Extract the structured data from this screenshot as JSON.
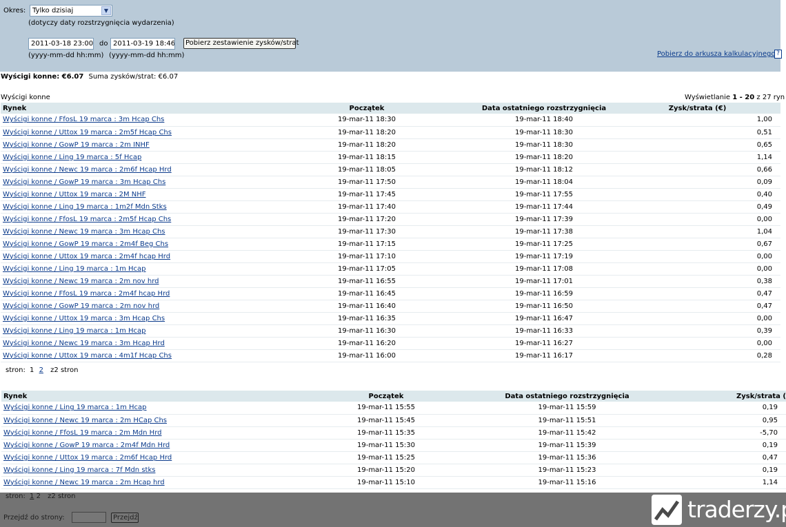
{
  "filter": {
    "period_label": "Okres:",
    "period_value": "Tylko dzisiaj",
    "period_note": "(dotyczy daty rozstrzygnięcia wydarzenia)",
    "date_from": "2011-03-18 23:00",
    "to_label": "do",
    "date_to": "2011-03-19 18:46",
    "fetch_button": "Pobierz zestawienie zysków/strat",
    "format_hint_from": "(yyyy-mm-dd hh:mm)",
    "format_hint_to": "(yyyy-mm-dd hh:mm)",
    "spreadsheet_link": "Pobierz do arkusza kalkulacyjnego",
    "help": "?"
  },
  "summary": {
    "category_total": "Wyścigi konne: €6.07",
    "sum_text": "Suma zysków/strat:  €6.07"
  },
  "section": {
    "title": "Wyścigi konne",
    "showing_prefix": "Wyświetlanie ",
    "showing_range": "1 - 20",
    "showing_suffix": " z 27 ryn"
  },
  "columns": {
    "market": "Rynek",
    "start": "Początek",
    "settled": "Data ostatniego rozstrzygnięcia",
    "pnl": "Zysk/strata (€)"
  },
  "columns2": {
    "market": "Rynek",
    "start": "Początek",
    "settled": "Data ostatniego rozstrzygnięcia",
    "pnl": "Zysk/strata ("
  },
  "rows1": [
    {
      "market": "Wyścigi konne / FfosL 19 marca : 3m Hcap Chs",
      "start": "19-mar-11 18:30",
      "settled": "19-mar-11 18:40",
      "pnl": "1,00"
    },
    {
      "market": "Wyścigi konne / Uttox 19 marca : 2m5f Hcap Chs",
      "start": "19-mar-11 18:20",
      "settled": "19-mar-11 18:30",
      "pnl": "0,51"
    },
    {
      "market": "Wyścigi konne / GowP 19 marca : 2m INHF",
      "start": "19-mar-11 18:20",
      "settled": "19-mar-11 18:30",
      "pnl": "0,65"
    },
    {
      "market": "Wyścigi konne / Ling 19 marca : 5f Hcap",
      "start": "19-mar-11 18:15",
      "settled": "19-mar-11 18:20",
      "pnl": "1,14"
    },
    {
      "market": "Wyścigi konne / Newc 19 marca : 2m6f Hcap Hrd",
      "start": "19-mar-11 18:05",
      "settled": "19-mar-11 18:12",
      "pnl": "0,66"
    },
    {
      "market": "Wyścigi konne / GowP 19 marca : 3m Hcap Chs",
      "start": "19-mar-11 17:50",
      "settled": "19-mar-11 18:04",
      "pnl": "0,09"
    },
    {
      "market": "Wyścigi konne / Uttox 19 marca : 2M NHF",
      "start": "19-mar-11 17:45",
      "settled": "19-mar-11 17:55",
      "pnl": "0,40"
    },
    {
      "market": "Wyścigi konne / Ling 19 marca : 1m2f Mdn Stks",
      "start": "19-mar-11 17:40",
      "settled": "19-mar-11 17:44",
      "pnl": "0,49"
    },
    {
      "market": "Wyścigi konne / FfosL 19 marca : 2m5f Hcap Chs",
      "start": "19-mar-11 17:20",
      "settled": "19-mar-11 17:39",
      "pnl": "0,00"
    },
    {
      "market": "Wyścigi konne / Newc 19 marca : 3m Hcap Chs",
      "start": "19-mar-11 17:30",
      "settled": "19-mar-11 17:38",
      "pnl": "1,04"
    },
    {
      "market": "Wyścigi konne / GowP 19 marca : 2m4f Beg Chs",
      "start": "19-mar-11 17:15",
      "settled": "19-mar-11 17:25",
      "pnl": "0,67"
    },
    {
      "market": "Wyścigi konne / Uttox 19 marca : 2m4f hcap Hrd",
      "start": "19-mar-11 17:10",
      "settled": "19-mar-11 17:19",
      "pnl": "0,00"
    },
    {
      "market": "Wyścigi konne / Ling 19 marca : 1m Hcap",
      "start": "19-mar-11 17:05",
      "settled": "19-mar-11 17:08",
      "pnl": "0,00"
    },
    {
      "market": "Wyścigi konne / Newc 19 marca : 2m nov hrd",
      "start": "19-mar-11 16:55",
      "settled": "19-mar-11 17:01",
      "pnl": "0,38"
    },
    {
      "market": "Wyścigi konne / FfosL 19 marca : 2m4f hcap Hrd",
      "start": "19-mar-11 16:45",
      "settled": "19-mar-11 16:59",
      "pnl": "0,47"
    },
    {
      "market": "Wyścigi konne / GowP 19 marca : 2m nov hrd",
      "start": "19-mar-11 16:40",
      "settled": "19-mar-11 16:50",
      "pnl": "0,47"
    },
    {
      "market": "Wyścigi konne / Uttox 19 marca : 3m Hcap Chs",
      "start": "19-mar-11 16:35",
      "settled": "19-mar-11 16:47",
      "pnl": "0,00"
    },
    {
      "market": "Wyścigi konne / Ling 19 marca : 1m Hcap",
      "start": "19-mar-11 16:30",
      "settled": "19-mar-11 16:33",
      "pnl": "0,39"
    },
    {
      "market": "Wyścigi konne / Newc 19 marca : 3m Hcap Hrd",
      "start": "19-mar-11 16:20",
      "settled": "19-mar-11 16:27",
      "pnl": "0,00"
    },
    {
      "market": "Wyścigi konne / Uttox 19 marca : 4m1f Hcap Chs",
      "start": "19-mar-11 16:00",
      "settled": "19-mar-11 16:17",
      "pnl": "0,28"
    }
  ],
  "pager1": {
    "label": "stron:",
    "current": "1",
    "next": "2",
    "suffix": "z2 stron"
  },
  "rows2": [
    {
      "market": "Wyścigi konne / Ling 19 marca : 1m Hcap",
      "start": "19-mar-11 15:55",
      "settled": "19-mar-11 15:59",
      "pnl": "0,19"
    },
    {
      "market": "Wyścigi konne / Newc 19 marca : 2m HCap Chs",
      "start": "19-mar-11 15:45",
      "settled": "19-mar-11 15:51",
      "pnl": "0,95"
    },
    {
      "market": "Wyścigi konne / FfosL 19 marca : 2m Mdn Hrd",
      "start": "19-mar-11 15:35",
      "settled": "19-mar-11 15:42",
      "pnl": "-5,70"
    },
    {
      "market": "Wyścigi konne / GowP 19 marca : 2m4f Mdn Hrd",
      "start": "19-mar-11 15:30",
      "settled": "19-mar-11 15:39",
      "pnl": "0,19"
    },
    {
      "market": "Wyścigi konne / Uttox 19 marca : 2m6f Hcap Hrd",
      "start": "19-mar-11 15:25",
      "settled": "19-mar-11 15:36",
      "pnl": "0,47"
    },
    {
      "market": "Wyścigi konne / Ling 19 marca : 7f Mdn stks",
      "start": "19-mar-11 15:20",
      "settled": "19-mar-11 15:23",
      "pnl": "0,19"
    },
    {
      "market": "Wyścigi konne / Newc 19 marca : 2m Hcap hrd",
      "start": "19-mar-11 15:10",
      "settled": "19-mar-11 15:16",
      "pnl": "1,14"
    }
  ],
  "pager2": {
    "label": "stron:",
    "first": "1",
    "current": "2",
    "suffix": "z2 stron"
  },
  "goto": {
    "label": "Przejdź do strony:",
    "value": "",
    "button": "Przejdź"
  },
  "watermark": {
    "brand": "traderzy.pl"
  }
}
